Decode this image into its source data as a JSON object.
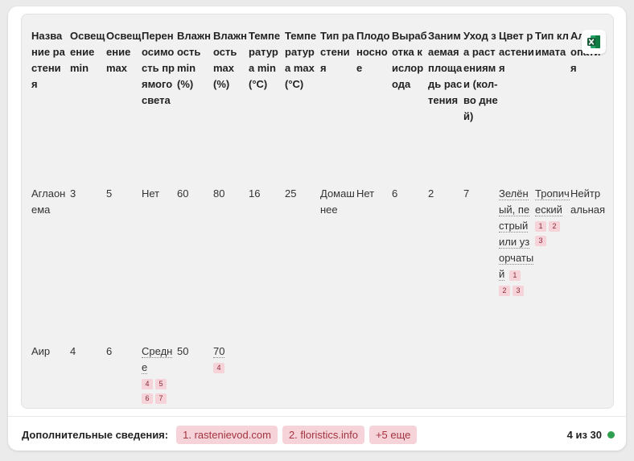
{
  "columns": [
    "Название растения",
    "Освещение min",
    "Освещение max",
    "Переносимость прямого света",
    "Влажность min (%)",
    "Влажность max (%)",
    "Температура min (°C)",
    "Температура max (°C)",
    "Тип растения",
    "Плодоносное",
    "Выработка кислорода",
    "Занимаемая площадь растения",
    "Уход за растениями (кол-во дней)",
    "Цвет растения",
    "Тип климата",
    "Аллелопатия"
  ],
  "rows": [
    {
      "name": "Аглаонема",
      "light_min": "3",
      "light_max": "5",
      "direct_light": "Нет",
      "hum_min": "60",
      "hum_max": "80",
      "temp_min": "16",
      "temp_max": "25",
      "type": "Домашнее",
      "fruit": "Нет",
      "oxygen": "6",
      "area": "2",
      "care": "7",
      "color": "Зелёный, пестрый или узорчатый",
      "color_refs": [
        "1",
        "2",
        "3"
      ],
      "climate": "Тропический",
      "climate_refs": [
        "1",
        "2",
        "3"
      ],
      "allelopathy": "Нейтральная"
    },
    {
      "name": "Аир",
      "light_min": "4",
      "light_max": "6",
      "direct_light": "Средне",
      "direct_light_refs": [
        "4",
        "5",
        "6",
        "7"
      ],
      "hum_min": "50",
      "hum_max": "70",
      "hum_max_refs": [
        "4"
      ]
    }
  ],
  "footer": {
    "label": "Дополнительные сведения:",
    "sources": [
      "1. rastenievod.com",
      "2. floristics.info",
      "+5 еще"
    ],
    "counter": "4 из 30",
    "status_color": "#2e9e4f"
  },
  "icons": {
    "export": "excel-icon"
  }
}
